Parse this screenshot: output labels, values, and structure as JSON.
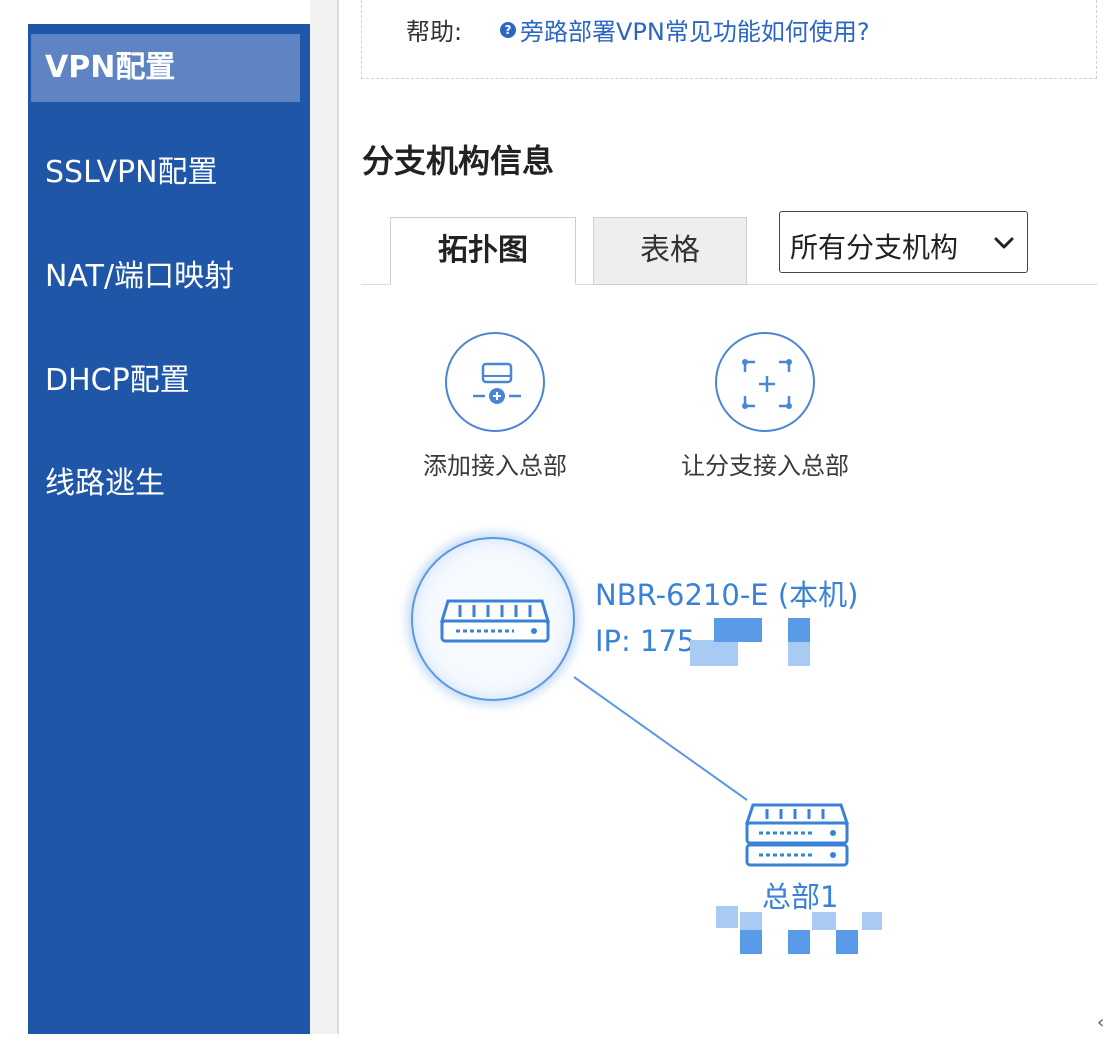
{
  "sidebar": {
    "items": [
      {
        "label": "VPN配置",
        "active": true
      },
      {
        "label": "SSLVPN配置",
        "active": false
      },
      {
        "label": "NAT/端口映射",
        "active": false
      },
      {
        "label": "DHCP配置",
        "active": false
      },
      {
        "label": "线路逃生",
        "active": false
      }
    ],
    "bg_color": "#1f56a8",
    "active_color": "#5f84c4"
  },
  "help": {
    "label": "帮助:",
    "icon": "question-circle-icon",
    "link_text": "旁路部署VPN常见功能如何使用?"
  },
  "section": {
    "title": "分支机构信息"
  },
  "tabs": [
    {
      "label": "拓扑图",
      "active": true
    },
    {
      "label": "表格",
      "active": false
    }
  ],
  "filter": {
    "selected": "所有分支机构",
    "icon": "chevron-down-icon"
  },
  "actions": [
    {
      "label": "添加接入总部",
      "icon": "add-device-icon"
    },
    {
      "label": "让分支接入总部",
      "icon": "add-frame-icon"
    }
  ],
  "topology": {
    "local_device": {
      "name": "NBR-6210-E (本机)",
      "ip": "IP: 175",
      "icon": "router-icon"
    },
    "hq": {
      "label": "总部1",
      "icon": "server-stack-icon"
    },
    "accent_color": "#3a82d8"
  }
}
